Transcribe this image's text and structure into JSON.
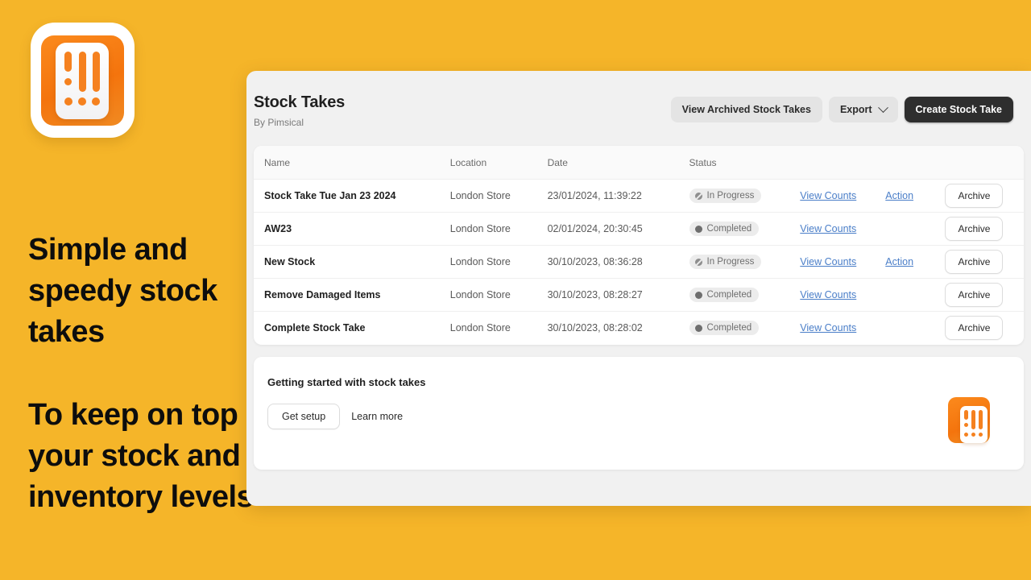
{
  "promo": {
    "headline": "Simple and speedy stock takes",
    "subline": "To keep on top of your stock and inventory levels",
    "background_color": "#f5b529",
    "logo_icon": "stock-takes-app-logo"
  },
  "app": {
    "title": "Stock Takes",
    "subtitle": "By Pimsical",
    "actions": {
      "view_archived": "View Archived Stock Takes",
      "export": "Export",
      "export_chevron_icon": "chevron-down-icon",
      "create": "Create Stock Take"
    }
  },
  "table": {
    "columns": [
      "Name",
      "Location",
      "Date",
      "Status"
    ],
    "rows": [
      {
        "name": "Stock Take Tue Jan 23 2024",
        "location": "London Store",
        "date": "23/01/2024, 11:39:22",
        "status": "In Progress",
        "status_icon": "in-progress-icon",
        "view_counts": "View Counts",
        "action": "Action",
        "archive": "Archive"
      },
      {
        "name": "AW23",
        "location": "London Store",
        "date": "02/01/2024, 20:30:45",
        "status": "Completed",
        "status_icon": "completed-icon",
        "view_counts": "View Counts",
        "action": "",
        "archive": "Archive"
      },
      {
        "name": "New Stock",
        "location": "London Store",
        "date": "30/10/2023, 08:36:28",
        "status": "In Progress",
        "status_icon": "in-progress-icon",
        "view_counts": "View Counts",
        "action": "Action",
        "archive": "Archive"
      },
      {
        "name": "Remove Damaged Items",
        "location": "London Store",
        "date": "30/10/2023, 08:28:27",
        "status": "Completed",
        "status_icon": "completed-icon",
        "view_counts": "View Counts",
        "action": "",
        "archive": "Archive"
      },
      {
        "name": "Complete Stock Take",
        "location": "London Store",
        "date": "30/10/2023, 08:28:02",
        "status": "Completed",
        "status_icon": "completed-icon",
        "view_counts": "View Counts",
        "action": "",
        "archive": "Archive"
      }
    ]
  },
  "getting_started": {
    "title": "Getting started with stock takes",
    "setup_label": "Get setup",
    "learn_more_label": "Learn more",
    "logo_icon": "stock-takes-app-logo"
  },
  "colors": {
    "brand_yellow": "#f5b529",
    "brand_orange": "#f5811f",
    "link_blue": "#4a7ec8",
    "dark_button": "#2e2e2e"
  }
}
